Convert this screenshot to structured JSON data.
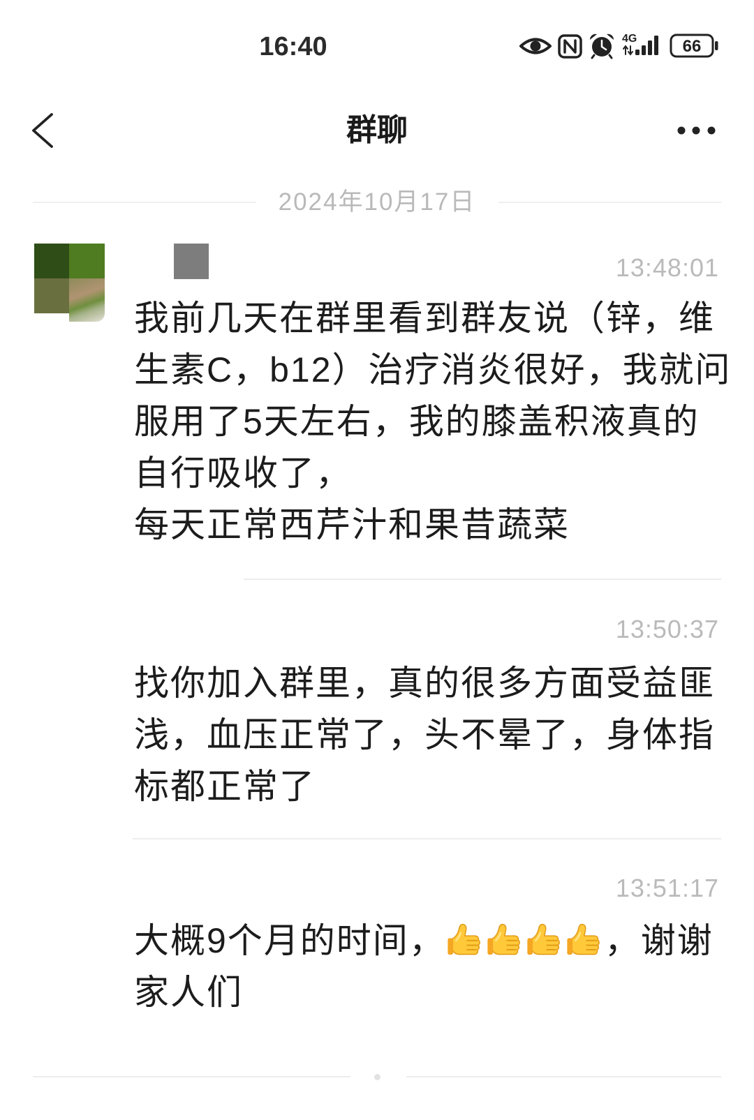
{
  "status_bar": {
    "time": "16:40",
    "network": "4G",
    "battery_level": "66",
    "icons": [
      "eye-icon",
      "nfc-icon",
      "alarm-icon",
      "signal-icon",
      "battery-icon"
    ]
  },
  "header": {
    "title": "群聊",
    "back_icon": "chevron-left-icon",
    "more_icon": "more-icon"
  },
  "date_separator": "2024年10月17日",
  "messages": [
    {
      "time": "13:48:01",
      "lines": [
        "我前几天在群里看到群友说（锌，维",
        "生素C，b12）治疗消炎很好，我就问",
        "服用了5天左右，我的膝盖积液真的",
        "自行吸收了，",
        "每天正常西芹汁和果昔蔬菜"
      ]
    },
    {
      "time": "13:50:37",
      "lines": [
        "找你加入群里，真的很多方面受益匪",
        "浅，血压正常了，头不晕了，身体指",
        "标都正常了"
      ]
    },
    {
      "time": "13:51:17",
      "lines": [
        {
          "before": "大概9个月的时间，",
          "emoji": "thumbs-up-icon",
          "emoji_count": 4,
          "after": "，谢谢"
        },
        "家人们"
      ]
    }
  ]
}
